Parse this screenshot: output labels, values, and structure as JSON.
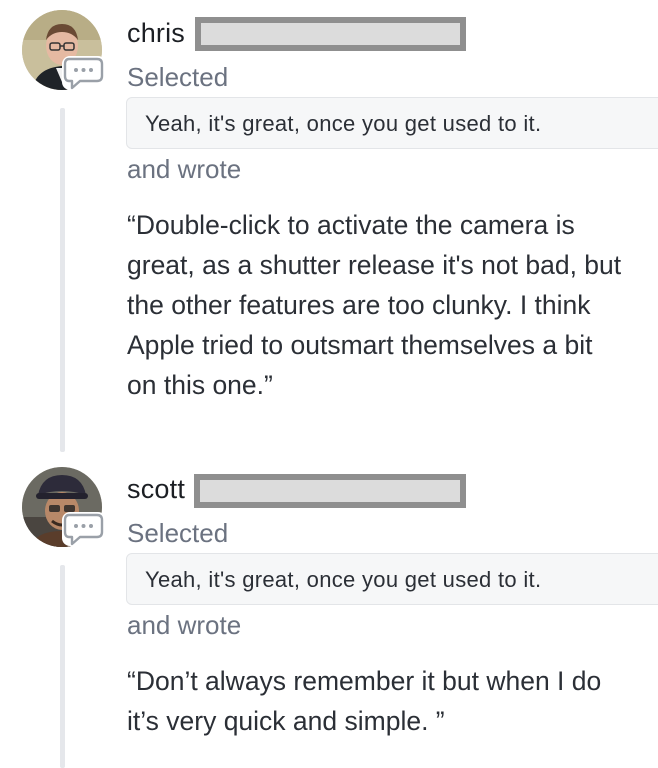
{
  "comments": [
    {
      "username": "chris",
      "selected_label": "Selected",
      "selection": "Yeah, it's great, once you get used to it.",
      "wrote_label": "and wrote",
      "text": "“Double-click to activate the camera is great, as a shutter release it's not bad, but the other features are too clunky. I think Apple tried to outsmart themselves a bit on this one.”"
    },
    {
      "username": "scott",
      "selected_label": "Selected",
      "selection": "Yeah, it's great, once you get used to it.",
      "wrote_label": "and wrote",
      "text": "“Don’t always remember it but when I do it’s very quick and simple. ”"
    }
  ],
  "icons": {
    "comment": "speech-bubble-icon"
  },
  "colors": {
    "thread_line": "#e5e7eb",
    "redaction_fill": "#dcdcdc",
    "redaction_border": "#8f8f8f",
    "muted_text": "#6b7280"
  }
}
